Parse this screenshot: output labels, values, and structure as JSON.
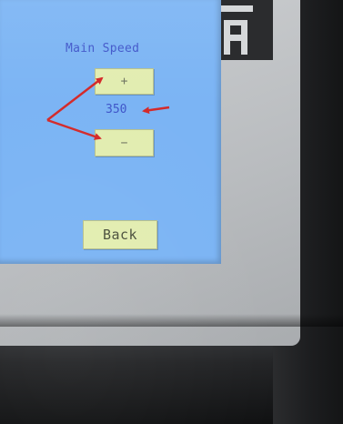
{
  "screen": {
    "title": "Main Speed",
    "increase_label": "+",
    "decrease_label": "−",
    "speed_value": "350",
    "back_label": "Back"
  },
  "colors": {
    "screen_background": "#7bb4f4",
    "button_fill": "#e2edb0",
    "text_blue": "#3f55c9",
    "annotation_red": "#d42a2a",
    "bezel_grey": "#bfc2c5",
    "case_dark": "#1d1e20"
  },
  "annotations": {
    "arrow_count": 3,
    "arrow_targets": [
      "increase-button",
      "decrease-button",
      "speed-value"
    ]
  },
  "logo": {
    "icon": "brand-logo-icon"
  }
}
